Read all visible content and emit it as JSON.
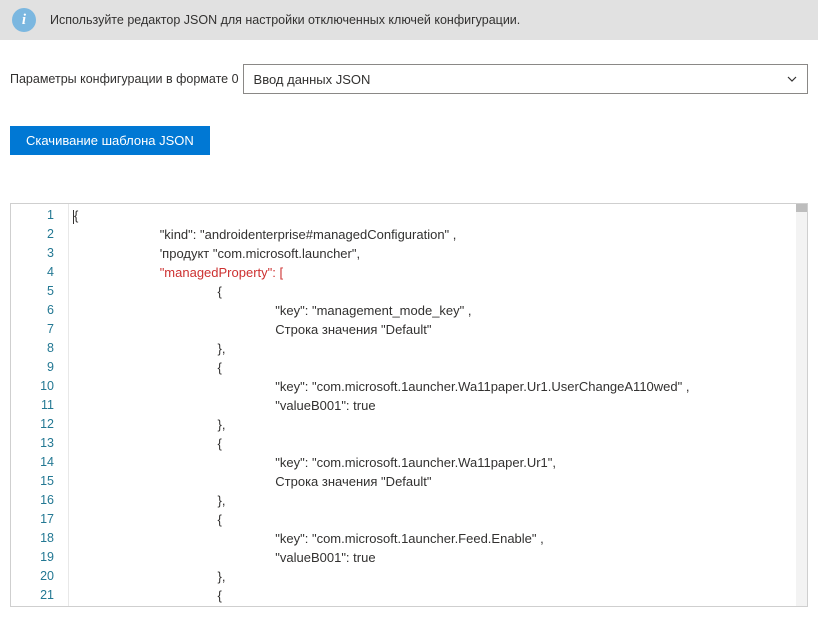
{
  "banner": {
    "icon_glyph": "i",
    "text": "Используйте редактор JSON для настройки отключенных ключей конфигурации."
  },
  "field": {
    "label": "Параметры конфигурации в формате 0",
    "selected": "Ввод данных JSON"
  },
  "button": {
    "download_label": "Скачивание шаблона JSON"
  },
  "editor": {
    "line_count": 21,
    "lines": [
      [
        {
          "t": "{",
          "c": "brace",
          "indent": 0,
          "cursor_before": true
        }
      ],
      [
        {
          "t": "\"kind\": \"androidenterprise#managedConfiguration\" ,",
          "c": "plain",
          "indent": 3
        }
      ],
      [
        {
          "t": "'продукт \"com.microsoft.launcher\",",
          "c": "plain",
          "indent": 3
        }
      ],
      [
        {
          "t": "\"managedProperty\": [",
          "c": "err",
          "indent": 3
        }
      ],
      [
        {
          "t": "{",
          "c": "brace",
          "indent": 5
        }
      ],
      [
        {
          "t": "\"key\": \"management_mode_key\" ,",
          "c": "plain",
          "indent": 7
        }
      ],
      [
        {
          "t": "Строка значения \"Default\"",
          "c": "plain",
          "indent": 7
        }
      ],
      [
        {
          "t": "},",
          "c": "brace",
          "indent": 5
        }
      ],
      [
        {
          "t": "{",
          "c": "brace",
          "indent": 5
        }
      ],
      [
        {
          "t": "\"key\": \"com.microsoft.1auncher.Wa11paper.Ur1.UserChangeA110wed\" ,",
          "c": "plain",
          "indent": 7
        }
      ],
      [
        {
          "t": "\"valueB001\": true",
          "c": "plain",
          "indent": 7
        }
      ],
      [
        {
          "t": "},",
          "c": "brace",
          "indent": 5
        }
      ],
      [
        {
          "t": "{",
          "c": "brace",
          "indent": 5
        }
      ],
      [
        {
          "t": "\"key\": \"com.microsoft.1auncher.Wa11paper.Ur1\",",
          "c": "plain",
          "indent": 7
        }
      ],
      [
        {
          "t": "Строка значения \"Default\"",
          "c": "plain",
          "indent": 7
        }
      ],
      [
        {
          "t": "},",
          "c": "brace",
          "indent": 5
        }
      ],
      [
        {
          "t": "{",
          "c": "brace",
          "indent": 5
        }
      ],
      [
        {
          "t": "\"key\": \"com.microsoft.1auncher.Feed.Enable\" ,",
          "c": "plain",
          "indent": 7
        }
      ],
      [
        {
          "t": "\"valueB001\": true",
          "c": "plain",
          "indent": 7
        }
      ],
      [
        {
          "t": "},",
          "c": "brace",
          "indent": 5
        }
      ],
      [
        {
          "t": "{",
          "c": "brace",
          "indent": 5
        }
      ]
    ]
  }
}
